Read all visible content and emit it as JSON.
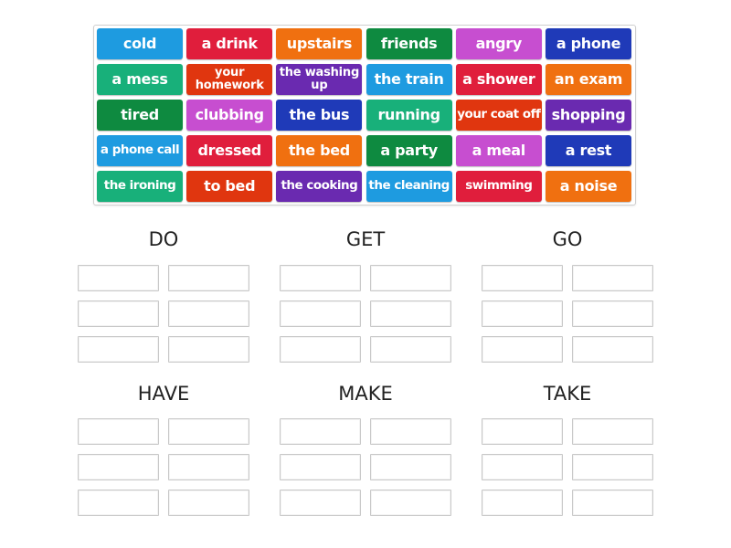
{
  "tiles": [
    {
      "label": "cold",
      "color": "#1e9be0"
    },
    {
      "label": "a drink",
      "color": "#e01e3c"
    },
    {
      "label": "upstairs",
      "color": "#f07010"
    },
    {
      "label": "friends",
      "color": "#0e8a40"
    },
    {
      "label": "angry",
      "color": "#c74ed0"
    },
    {
      "label": "a phone",
      "color": "#1f3ab8"
    },
    {
      "label": "a mess",
      "color": "#18b07a"
    },
    {
      "label": "your homework",
      "color": "#e0360f"
    },
    {
      "label": "the washing up",
      "color": "#6a2ab0"
    },
    {
      "label": "the train",
      "color": "#1e9be0"
    },
    {
      "label": "a shower",
      "color": "#e01e3c"
    },
    {
      "label": "an exam",
      "color": "#f07010"
    },
    {
      "label": "tired",
      "color": "#0e8a40"
    },
    {
      "label": "clubbing",
      "color": "#c74ed0"
    },
    {
      "label": "the bus",
      "color": "#1f3ab8"
    },
    {
      "label": "running",
      "color": "#18b07a"
    },
    {
      "label": "your coat off",
      "color": "#e0360f"
    },
    {
      "label": "shopping",
      "color": "#6a2ab0"
    },
    {
      "label": "a phone call",
      "color": "#1e9be0"
    },
    {
      "label": "dressed",
      "color": "#e01e3c"
    },
    {
      "label": "the bed",
      "color": "#f07010"
    },
    {
      "label": "a party",
      "color": "#0e8a40"
    },
    {
      "label": "a meal",
      "color": "#c74ed0"
    },
    {
      "label": "a rest",
      "color": "#1f3ab8"
    },
    {
      "label": "the ironing",
      "color": "#18b07a"
    },
    {
      "label": "to bed",
      "color": "#e0360f"
    },
    {
      "label": "the cooking",
      "color": "#6a2ab0"
    },
    {
      "label": "the cleaning",
      "color": "#1e9be0"
    },
    {
      "label": "swimming",
      "color": "#e01e3c"
    },
    {
      "label": "a noise",
      "color": "#f07010"
    }
  ],
  "groups": [
    {
      "title": "DO",
      "slots": 6
    },
    {
      "title": "GET",
      "slots": 6
    },
    {
      "title": "GO",
      "slots": 6
    },
    {
      "title": "HAVE",
      "slots": 6
    },
    {
      "title": "MAKE",
      "slots": 6
    },
    {
      "title": "TAKE",
      "slots": 6
    }
  ]
}
